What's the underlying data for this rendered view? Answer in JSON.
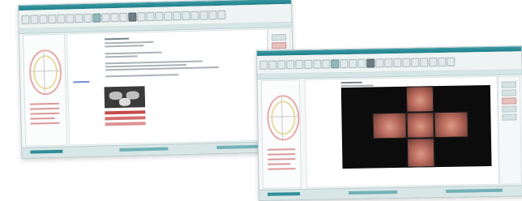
{
  "window_back": {
    "title": "",
    "toolbar_icons": [
      "tool-icon",
      "tool-icon",
      "tool-icon",
      "tool-icon",
      "tool-icon",
      "tool-icon",
      "tool-icon",
      "tool-icon"
    ]
  },
  "window_front": {
    "title": "",
    "toolbar_icons": [
      "tool-icon",
      "tool-icon",
      "tool-icon",
      "tool-icon",
      "tool-icon",
      "tool-icon",
      "tool-icon",
      "tool-icon"
    ]
  },
  "colors": {
    "accent": "#1f7f89",
    "arch_upper": "#e6a9a9",
    "arch_lower": "#e8dda0"
  }
}
